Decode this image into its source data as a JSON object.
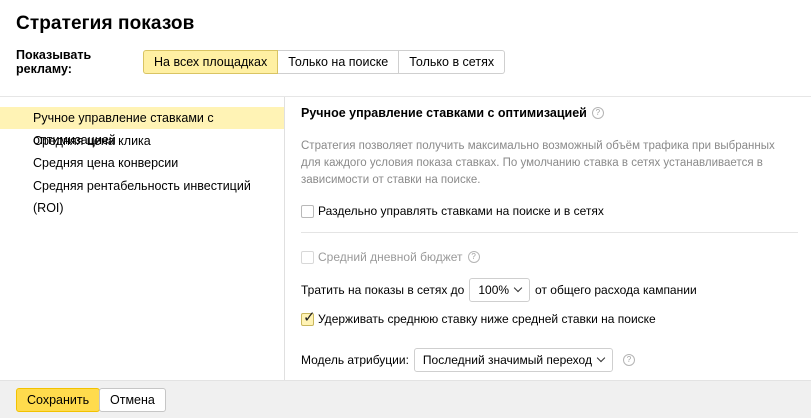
{
  "title": "Стратегия показов",
  "show_ads": {
    "label": "Показывать рекламу:",
    "options": [
      "На всех площадках",
      "Только на поиске",
      "Только в сетях"
    ],
    "selected_index": 0
  },
  "strategies": {
    "items": [
      "Ручное управление ставками с оптимизацией",
      "Средняя цена клика",
      "Средняя цена конверсии",
      "Средняя рентабельность инвестиций (ROI)"
    ],
    "selected_index": 0
  },
  "details": {
    "title": "Ручное управление ставками с оптимизацией",
    "help_glyph": "?",
    "description": "Стратегия позволяет получить максимально возможный объём трафика при выбранных для каждого условия показа ставках. По умолчанию ставка в сетях устанавливается в зависимости от ставки на поиске.",
    "separate_bids": {
      "label": "Раздельно управлять ставками на поиске и в сетях",
      "checked": false
    },
    "daily_budget": {
      "label": "Средний дневной бюджет",
      "checked": false,
      "disabled": true
    },
    "network_spend": {
      "prefix": "Тратить на показы в сетях до",
      "value": "100%",
      "suffix": "от общего расхода кампании"
    },
    "keep_avg_bid": {
      "label": "Удерживать среднюю ставку ниже средней ставки на поиске",
      "checked": true
    },
    "attribution": {
      "label": "Модель атрибуции:",
      "value": "Последний значимый переход"
    }
  },
  "footer": {
    "save_label": "Сохранить",
    "cancel_label": "Отмена"
  },
  "colors": {
    "selected_bg": "#fff3b5",
    "primary_button": "#ffdb4d",
    "muted_text": "#8a8a8a"
  }
}
